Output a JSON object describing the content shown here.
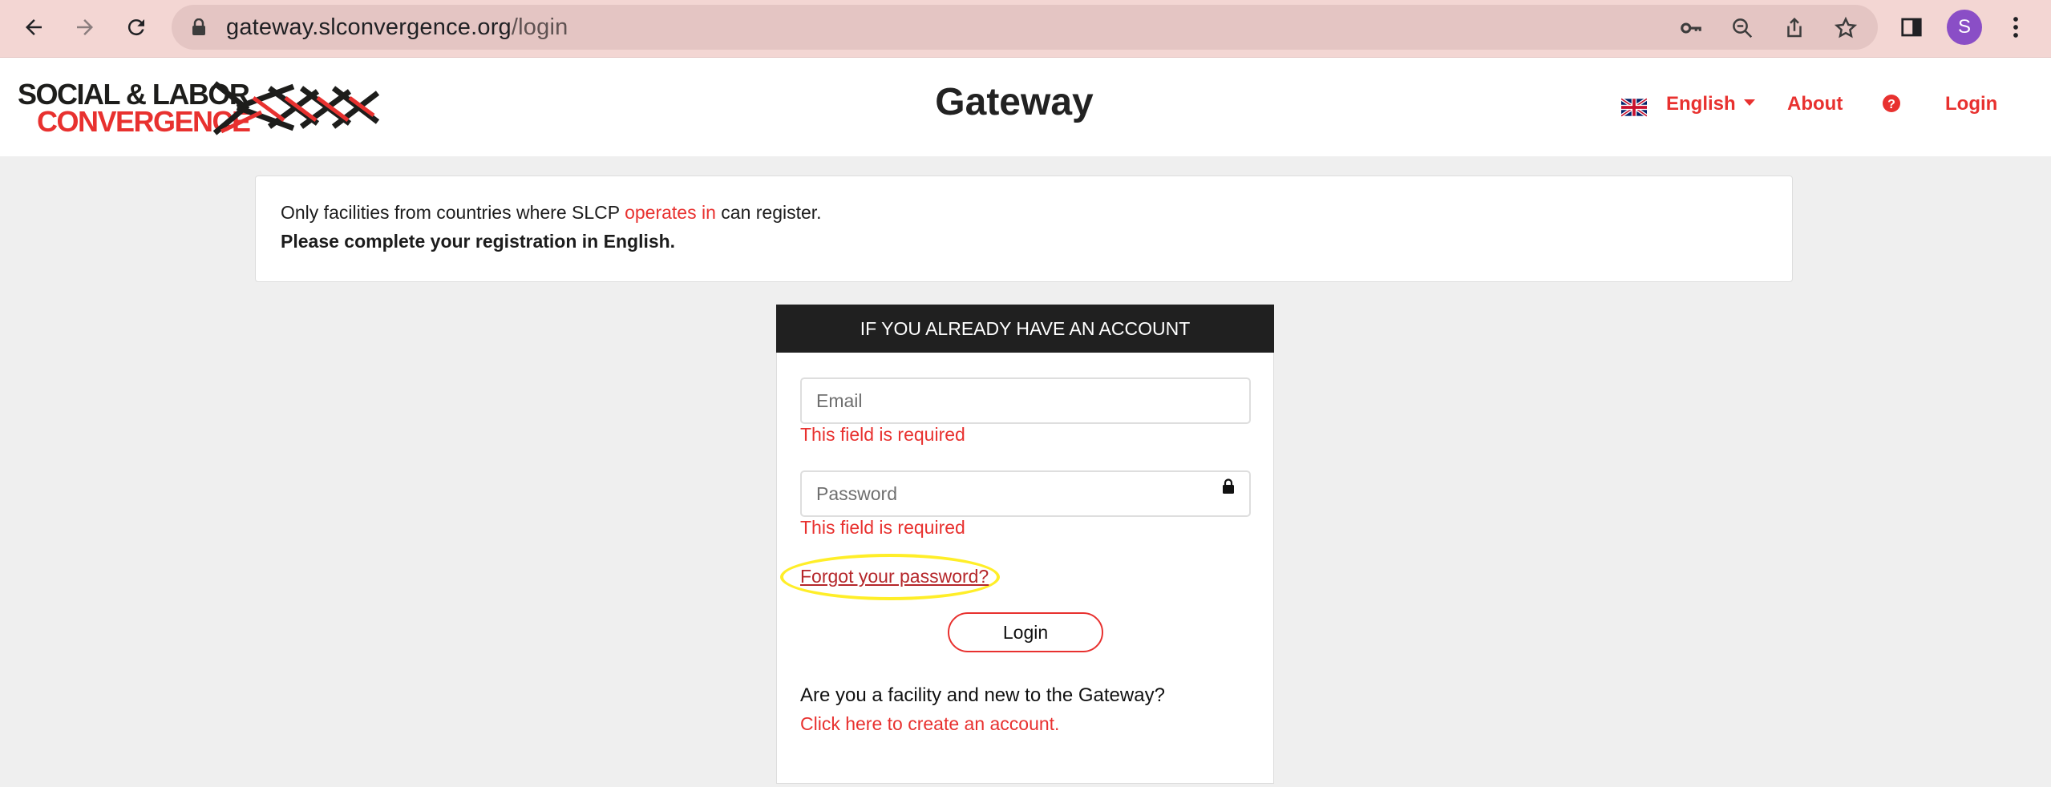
{
  "browser": {
    "url_host": "gateway.slconvergence.org",
    "url_path": "/login",
    "profile_initial": "S",
    "icons": [
      "back-arrow-icon",
      "forward-arrow-icon",
      "reload-icon",
      "lock-icon",
      "key-icon",
      "zoom-icon",
      "share-icon",
      "star-icon",
      "sidebar-icon",
      "kebab-menu-icon"
    ]
  },
  "header": {
    "logo_line1": "SOCIAL & LABOR",
    "logo_line2": "CONVERGENCE",
    "title": "Gateway",
    "language": "English",
    "about": "About",
    "login": "Login",
    "help_icon": "question-circle-icon",
    "flag_icon": "uk-flag-icon"
  },
  "notice": {
    "line1_before": "Only facilities from countries where SLCP ",
    "line1_link": "operates in",
    "line1_after": " can register.",
    "line2": "Please complete your registration in English."
  },
  "login_form": {
    "heading": "IF YOU ALREADY HAVE AN ACCOUNT",
    "email_placeholder": "Email",
    "email_value": "",
    "email_error": "This field is required",
    "password_placeholder": "Password",
    "password_value": "",
    "password_error": "This field is required",
    "forgot_link": "Forgot your password?",
    "login_button": "Login",
    "new_question": "Are you a facility and new to the Gateway?",
    "create_link": "Click here to create an account."
  },
  "colors": {
    "brand_red": "#e8312f",
    "dark": "#202020",
    "chrome_bar": "#f3d6d3",
    "highlight": "#ffee28"
  }
}
